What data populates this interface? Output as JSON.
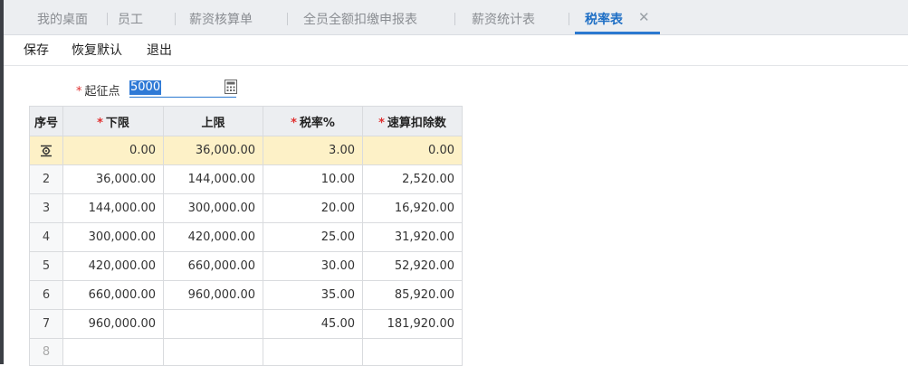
{
  "tabs": [
    {
      "label": "我的桌面",
      "active": false
    },
    {
      "label": "员工",
      "active": false
    },
    {
      "label": "薪资核算单",
      "active": false
    },
    {
      "label": "全员全额扣缴申报表",
      "active": false
    },
    {
      "label": "薪资统计表",
      "active": false
    },
    {
      "label": "税率表",
      "active": true
    }
  ],
  "toolbar": {
    "save_label": "保存",
    "restore_label": "恢复默认",
    "exit_label": "退出"
  },
  "threshold": {
    "label": "起征点",
    "value": "5000",
    "required": true
  },
  "table": {
    "headers": [
      {
        "label": "序号",
        "required": false
      },
      {
        "label": "下限",
        "required": true
      },
      {
        "label": "上限",
        "required": false
      },
      {
        "label": "税率%",
        "required": true
      },
      {
        "label": "速算扣除数",
        "required": true
      }
    ],
    "rows": [
      {
        "idx": "",
        "lower": "0.00",
        "upper": "36,000.00",
        "rate": "3.00",
        "deduction": "0.00",
        "selected": true
      },
      {
        "idx": "2",
        "lower": "36,000.00",
        "upper": "144,000.00",
        "rate": "10.00",
        "deduction": "2,520.00"
      },
      {
        "idx": "3",
        "lower": "144,000.00",
        "upper": "300,000.00",
        "rate": "20.00",
        "deduction": "16,920.00"
      },
      {
        "idx": "4",
        "lower": "300,000.00",
        "upper": "420,000.00",
        "rate": "25.00",
        "deduction": "31,920.00"
      },
      {
        "idx": "5",
        "lower": "420,000.00",
        "upper": "660,000.00",
        "rate": "30.00",
        "deduction": "52,920.00"
      },
      {
        "idx": "6",
        "lower": "660,000.00",
        "upper": "960,000.00",
        "rate": "35.00",
        "deduction": "85,920.00"
      },
      {
        "idx": "7",
        "lower": "960,000.00",
        "upper": "",
        "rate": "45.00",
        "deduction": "181,920.00"
      },
      {
        "idx": "8",
        "lower": "",
        "upper": "",
        "rate": "",
        "deduction": ""
      }
    ]
  },
  "icons": {
    "tab_close": "close-icon",
    "calculator": "calculator-icon",
    "row_settings": "row-settings-icon"
  },
  "colors": {
    "accent": "#2b79d0",
    "required": "#e03030",
    "selected_row": "#fdf1c7",
    "header_bg": "#eceef1"
  }
}
